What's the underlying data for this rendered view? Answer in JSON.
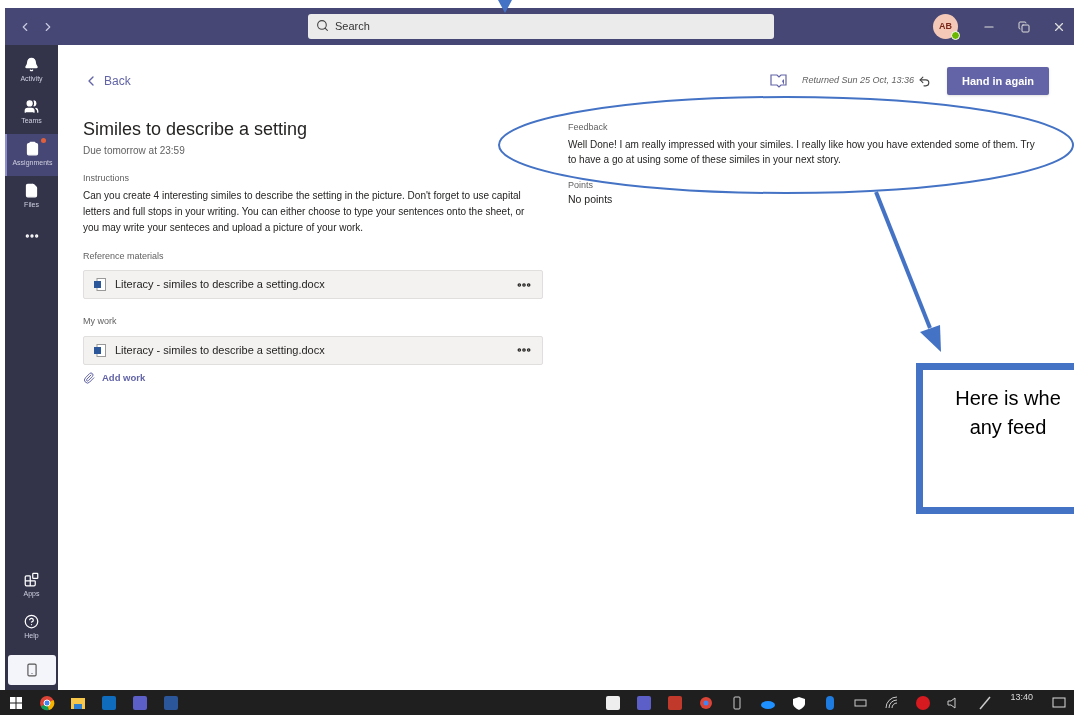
{
  "titlebar": {
    "search_placeholder": "Search",
    "avatar_initials": "AB"
  },
  "sidebar": {
    "items": [
      {
        "kind": "activity",
        "label": "Activity",
        "selected": false,
        "notification": false
      },
      {
        "kind": "teams",
        "label": "Teams",
        "selected": false,
        "notification": false
      },
      {
        "kind": "assignments",
        "label": "Assignments",
        "selected": true,
        "notification": true
      },
      {
        "kind": "files",
        "label": "Files",
        "selected": false,
        "notification": false
      }
    ],
    "bottom_items": [
      {
        "kind": "apps",
        "label": "Apps"
      },
      {
        "kind": "help",
        "label": "Help"
      }
    ]
  },
  "header": {
    "back": "Back",
    "returned": "Returned Sun 25 Oct, 13:36",
    "button": "Hand in again"
  },
  "assignment": {
    "title": "Similes to describe a setting",
    "due": "Due tomorrow at 23:59",
    "instructions_label": "Instructions",
    "instructions": "Can you create 4 interesting similes to describe the setting in the picture. Don't forget to use capital letters and full stops in your writing. You can either choose to type your sentences onto the sheet, or you may write your senteces and upload a picture of your work.",
    "reference_label": "Reference materials",
    "reference_files": [
      {
        "name": "Literacy - similes to describe a setting.docx"
      }
    ],
    "my_work_label": "My work",
    "my_work_files": [
      {
        "name": "Literacy - similes to describe a setting.docx"
      }
    ],
    "add_work": "Add work"
  },
  "feedback": {
    "label": "Feedback",
    "text": "Well Done! I am really impressed with your similes. I really like how you have extended some of them. Try to have a go at using some of these similes in your next story.",
    "points_label": "Points",
    "points": "No points"
  },
  "annotation": {
    "lines": [
      "Here is whe",
      "any feed"
    ]
  },
  "taskbar": {
    "clock": "13:40"
  }
}
